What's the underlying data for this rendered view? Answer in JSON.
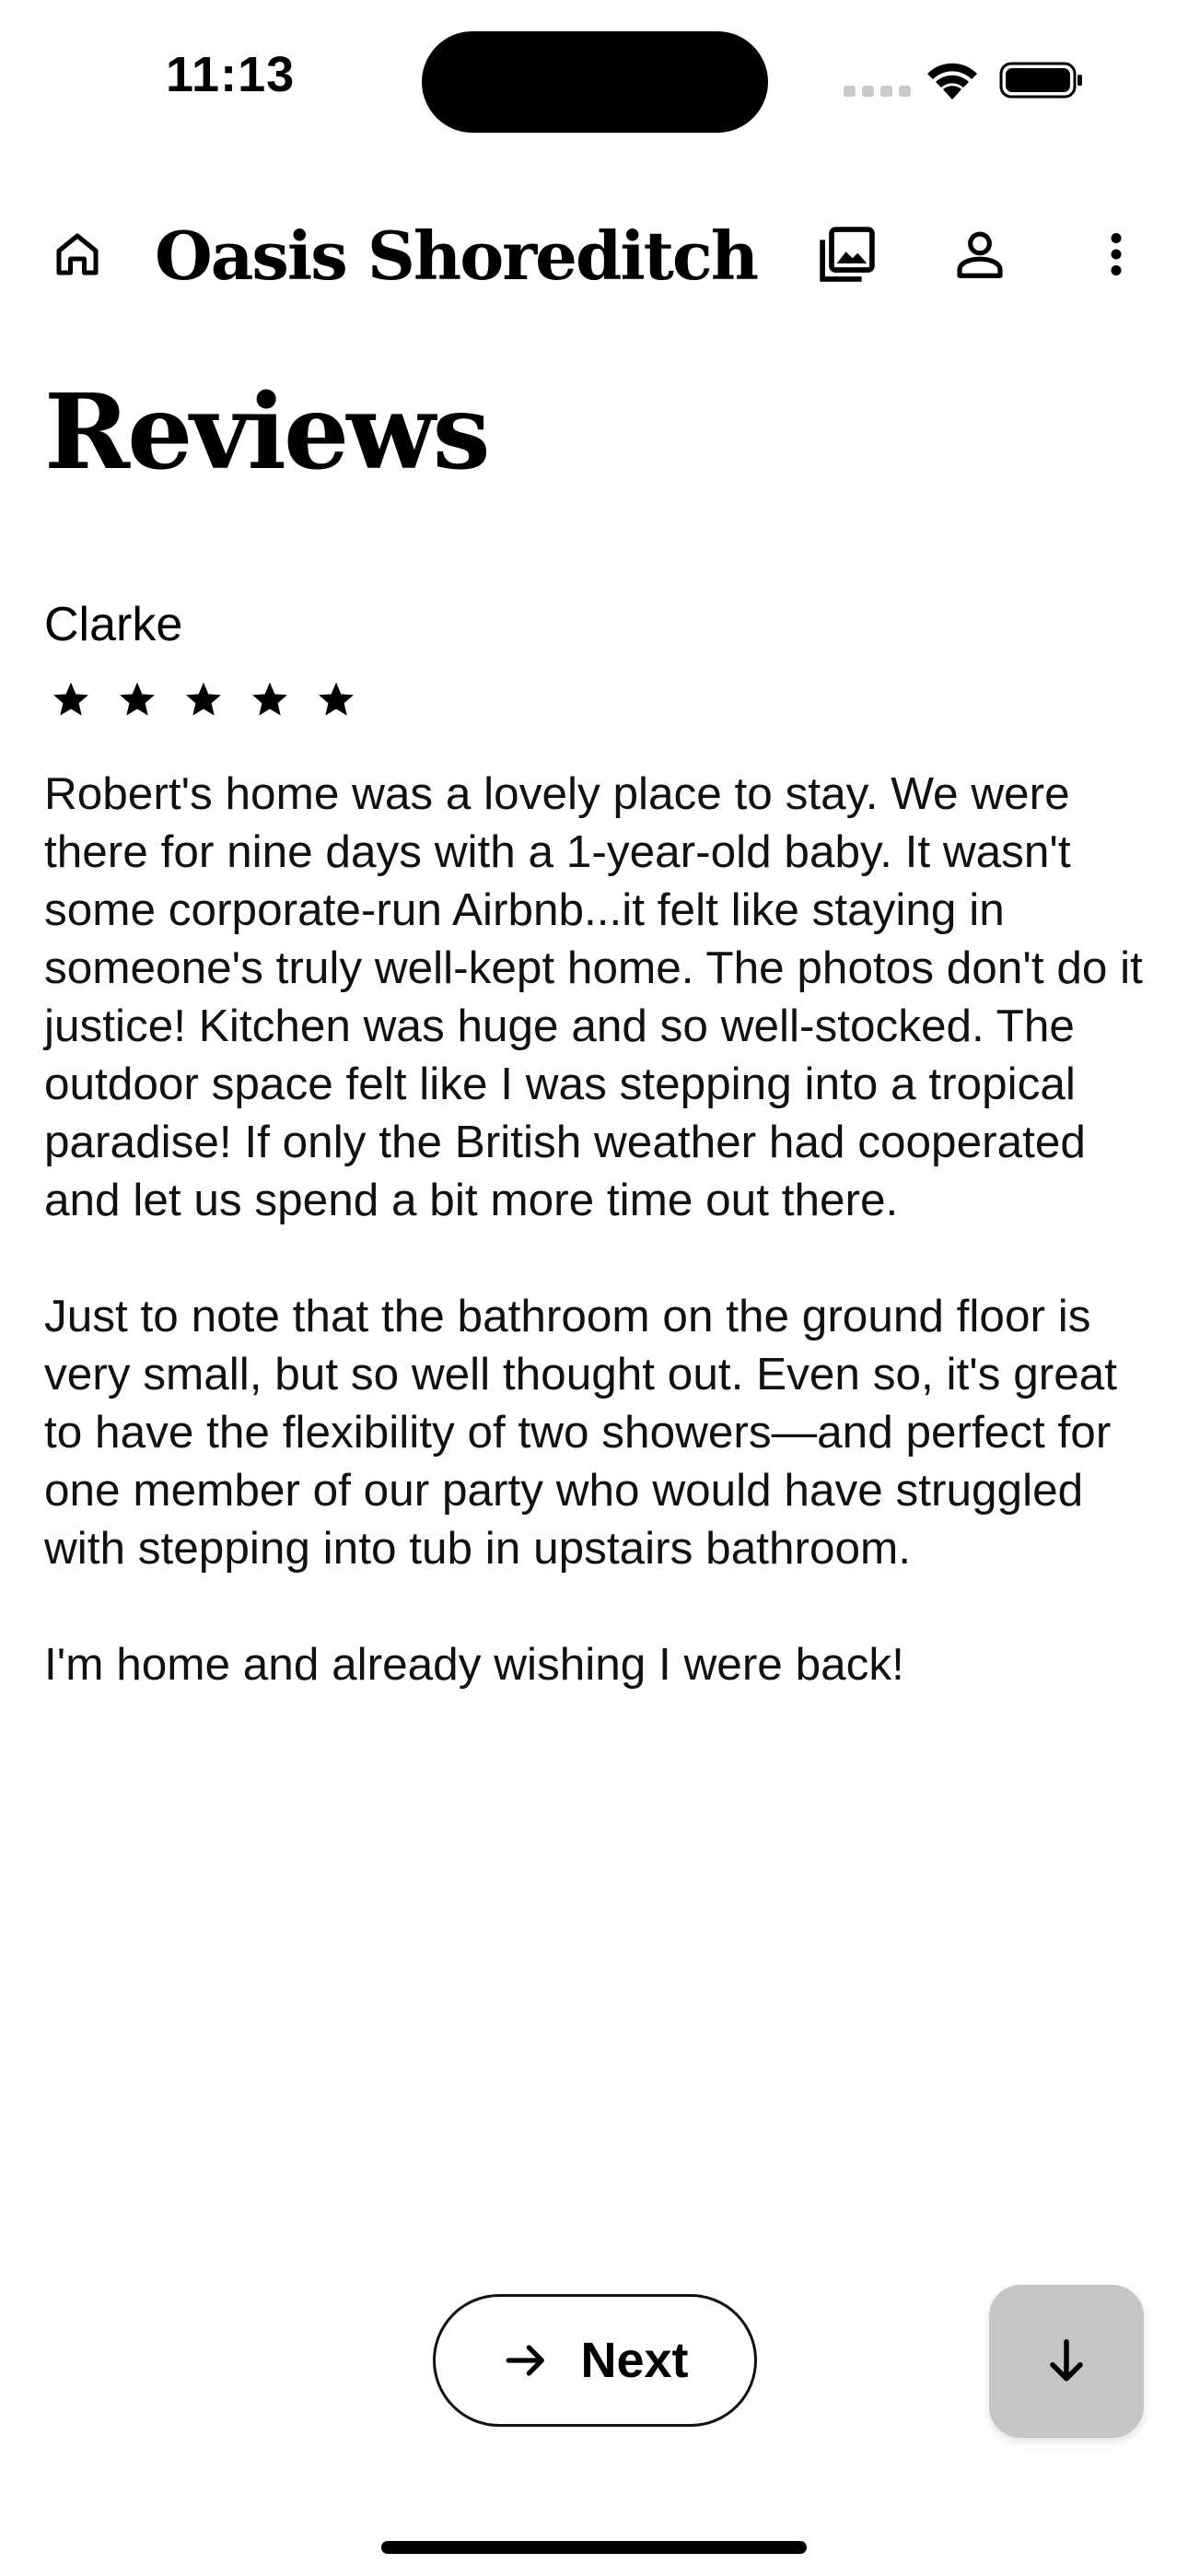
{
  "status_bar": {
    "time": "11:13"
  },
  "app_bar": {
    "title": "Oasis Shoreditch"
  },
  "page": {
    "heading": "Reviews"
  },
  "review": {
    "author": "Clarke",
    "rating": 5,
    "rating_max": 5,
    "paragraphs": [
      "Robert's home was a lovely place to stay. We were there for nine days with a 1-year-old baby. It wasn't some corporate-run Airbnb...it felt like staying in someone's truly well-kept home. The photos don't do it justice! Kitchen was huge and so well-stocked. The outdoor space felt like I was stepping into a tropical paradise! If only the British weather had cooperated and let us spend a bit more time out there.",
      "Just to note that the bathroom on the ground floor is very small, but so well thought out. Even so, it's great to have the flexibility of two showers—and perfect for one member of our party who would have struggled with stepping into tub in upstairs bathroom.",
      "I'm home and already wishing I were back!"
    ]
  },
  "controls": {
    "next_label": "Next"
  },
  "icons": {
    "home": "home-icon",
    "gallery": "photo-library-icon",
    "account": "person-icon",
    "more": "more-vert-icon",
    "next": "arrow-right-icon",
    "scroll_down": "arrow-down-icon",
    "star": "star-icon"
  },
  "colors": {
    "fab_background": "#c6c6c6",
    "text": "#000000"
  }
}
